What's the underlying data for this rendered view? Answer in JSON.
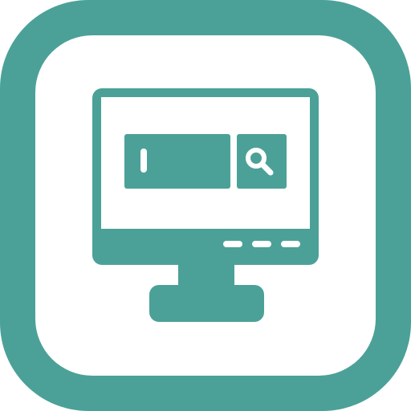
{
  "icon": {
    "name": "monitor-search-app-icon",
    "colors": {
      "primary": "#4BA198",
      "background": "#FFFFFF"
    },
    "parts": {
      "frame": "rounded-square-frame",
      "monitor": "monitor-icon",
      "search_field": "search-bar",
      "text_cursor": "text-cursor-icon",
      "search_button": "search-button",
      "magnifier": "magnifying-glass-icon",
      "indicators": "status-dash-indicators",
      "stand": "monitor-stand"
    }
  }
}
